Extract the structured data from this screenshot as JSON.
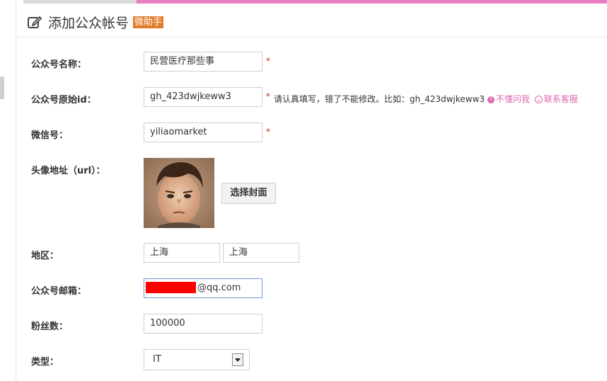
{
  "header": {
    "title": "添加公众帐号",
    "badge": "微助手"
  },
  "form": {
    "name": {
      "label": "公众号名称：",
      "value": "民营医疗那些事",
      "required": "*"
    },
    "original_id": {
      "label": "公众号原始id：",
      "value": "gh_423dwjkeww3",
      "required": "*",
      "hint": "请认真填写，错了不能修改。比如：gh_423dwjkeww3",
      "help_link": "不懂问我",
      "service_link": "联系客服"
    },
    "wechat": {
      "label": "微信号：",
      "value": "yiliaomarket",
      "required": "*"
    },
    "avatar": {
      "label": "头像地址（url）：",
      "button": "选择封面"
    },
    "region": {
      "label": "地区：",
      "province": "上海",
      "city": "上海"
    },
    "email": {
      "label": "公众号邮箱：",
      "value_suffix": "@qq.com"
    },
    "fans": {
      "label": "粉丝数：",
      "value": "100000"
    },
    "type": {
      "label": "类型：",
      "selected": "IT"
    }
  },
  "colors": {
    "accent_pink": "#e67fc2",
    "badge": "#e07d2b",
    "required": "#e02020",
    "link": "#e065b1"
  },
  "icons": {
    "header": "edit-icon",
    "help": "question-icon",
    "service": "smile-icon",
    "select": "chevron-down-icon"
  }
}
